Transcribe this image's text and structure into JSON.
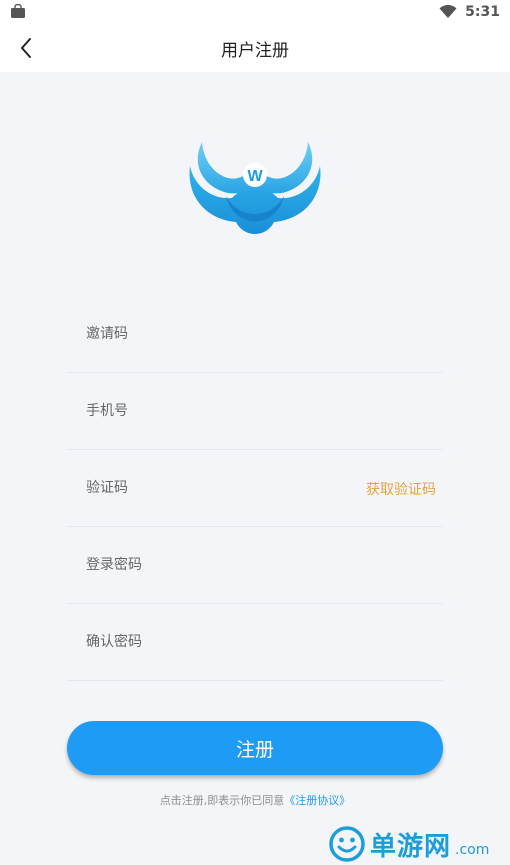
{
  "status_bar": {
    "time": "5:31",
    "icons": [
      "shopping-bag-icon",
      "wifi-icon"
    ]
  },
  "header": {
    "title": "用户注册",
    "back_icon": "chevron-left-icon"
  },
  "logo": {
    "icon": "app-logo",
    "letter": "W"
  },
  "form": {
    "invite_code": {
      "placeholder": "邀请码",
      "value": ""
    },
    "phone": {
      "placeholder": "手机号",
      "value": ""
    },
    "verification_code": {
      "placeholder": "验证码",
      "value": "",
      "action_label": "获取验证码"
    },
    "password": {
      "placeholder": "登录密码",
      "value": ""
    },
    "confirm_password": {
      "placeholder": "确认密码",
      "value": ""
    }
  },
  "submit": {
    "label": "注册"
  },
  "agreement": {
    "prefix": "点击注册,即表示你已同意",
    "link": "《注册协议》"
  },
  "watermark": {
    "text": "单游网",
    "suffix": ".com"
  },
  "colors": {
    "primary": "#1e9bf5",
    "action": "#e6a53a",
    "background": "#f3f5f8"
  }
}
